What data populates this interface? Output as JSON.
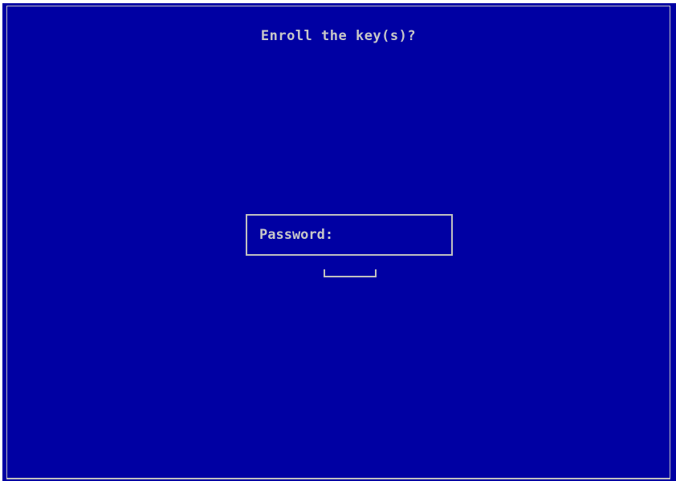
{
  "dialog": {
    "title": "Enroll the key(s)?",
    "password_label": "Password:",
    "password_value": ""
  },
  "colors": {
    "background": "#0000a3",
    "foreground": "#c8c8c8",
    "border": "#c0c0c0"
  }
}
